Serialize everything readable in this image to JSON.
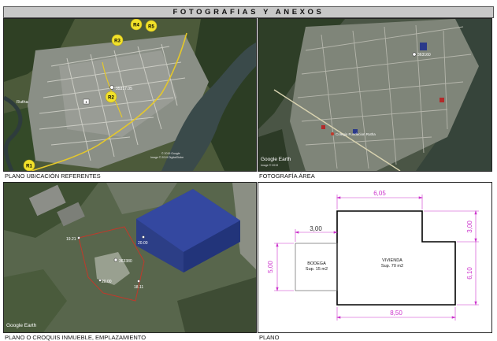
{
  "header": {
    "title": "FOTOGRAFIAS Y ANEXOS"
  },
  "panel_locations": {
    "caption": "PLANO UBICACIÓN REFERENTES",
    "markers": [
      "R4",
      "R5",
      "R3",
      "R2",
      "R1"
    ],
    "point_label": "35317.05",
    "town_label": "Rutha",
    "road_badge": "1",
    "attribution_line1": "© 2019 Google",
    "attribution_line2": "Image © 2019 DigitalGlobe"
  },
  "panel_aerial": {
    "caption": "FOTOGRAFÍA ÁREA",
    "point_label": "363160",
    "place_label": "Colegio Fundacion Rutha",
    "brand": "Google Earth",
    "attribution": "Image © 2019"
  },
  "panel_site": {
    "caption": "PLANO O CROQUIS INMUEBLE, EMPLAZAMIENTO",
    "point_label": "363380",
    "brand": "Google Earth",
    "vertex_labels": [
      "19.21",
      "20.00",
      "20.00",
      "18.11"
    ]
  },
  "panel_plan": {
    "caption": "PLANO",
    "dim_top_right": "6,05",
    "dim_top_left": "3,00",
    "dim_bottom": "8,50",
    "dim_left": "5,00",
    "dim_right_top": "3,00",
    "dim_right_bottom": "6,10",
    "bodega_name": "BODEGA",
    "bodega_area": "Sup. 15 m2",
    "vivienda_name": "VIVIENDA",
    "vivienda_area": "Sup. 70 m2",
    "colors": {
      "dimension": "#cc33cc",
      "wall": "#000000"
    }
  }
}
